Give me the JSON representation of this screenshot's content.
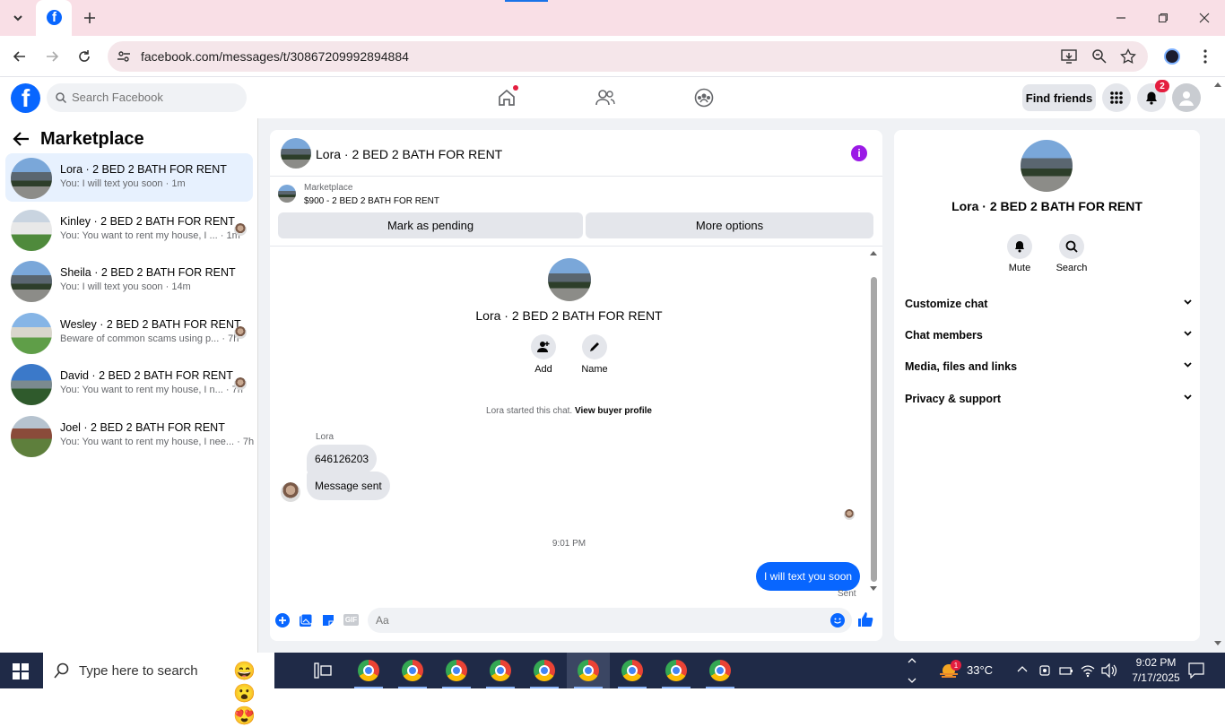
{
  "browser": {
    "url": "facebook.com/messages/t/30867209992894884"
  },
  "header": {
    "search_placeholder": "Search Facebook",
    "find_friends": "Find friends",
    "notification_count": "2"
  },
  "sidebar": {
    "title": "Marketplace",
    "conversations": [
      {
        "name": "Lora · 2 BED 2 BATH FOR RENT",
        "preview": "You: I will text you soon · 1m",
        "active": true
      },
      {
        "name": "Kinley · 2 BED 2 BATH FOR RENT",
        "preview": "You: You want to rent my house, I ... · 1m"
      },
      {
        "name": "Sheila · 2 BED 2 BATH FOR RENT",
        "preview": "You: I will text you soon · 14m"
      },
      {
        "name": "Wesley · 2 BED 2 BATH FOR RENT",
        "preview": "Beware of common scams using p... · 7h"
      },
      {
        "name": "David · 2 BED 2 BATH FOR RENT",
        "preview": "You: You want to rent my house, I n... · 7h"
      },
      {
        "name": "Joel · 2 BED 2 BATH FOR RENT",
        "preview": "You: You want to rent my house, I nee... · 7h"
      }
    ]
  },
  "chat": {
    "title": "Lora · 2 BED 2 BATH FOR RENT",
    "listing_source": "Marketplace",
    "listing_price_title": "$900 - 2 BED 2 BATH FOR RENT",
    "mark_pending": "Mark as pending",
    "more_options": "More options",
    "profile_name": "Lora · 2 BED 2 BATH FOR RENT",
    "add_label": "Add",
    "name_label": "Name",
    "started_text": "Lora started this chat.",
    "view_buyer": "View buyer profile",
    "sender_name": "Lora",
    "incoming": [
      "646126203",
      "Message sent"
    ],
    "timestamp": "9:01 PM",
    "outgoing": "I will text you soon",
    "sent_status": "Sent",
    "input_placeholder": "Aa"
  },
  "info_panel": {
    "name": "Lora · 2 BED 2 BATH FOR RENT",
    "mute": "Mute",
    "search": "Search",
    "sections": [
      "Customize chat",
      "Chat members",
      "Media, files and links",
      "Privacy & support"
    ]
  },
  "taskbar": {
    "search_placeholder": "Type here to search",
    "weather_temp": "33°C",
    "weather_badge": "1",
    "time": "9:02 PM",
    "date": "7/17/2025"
  },
  "colors": {
    "brand": "#0866ff",
    "tab_bg": "#f9dfe6",
    "info_purple": "#9b1ae6",
    "taskbar": "#1f2a47"
  }
}
